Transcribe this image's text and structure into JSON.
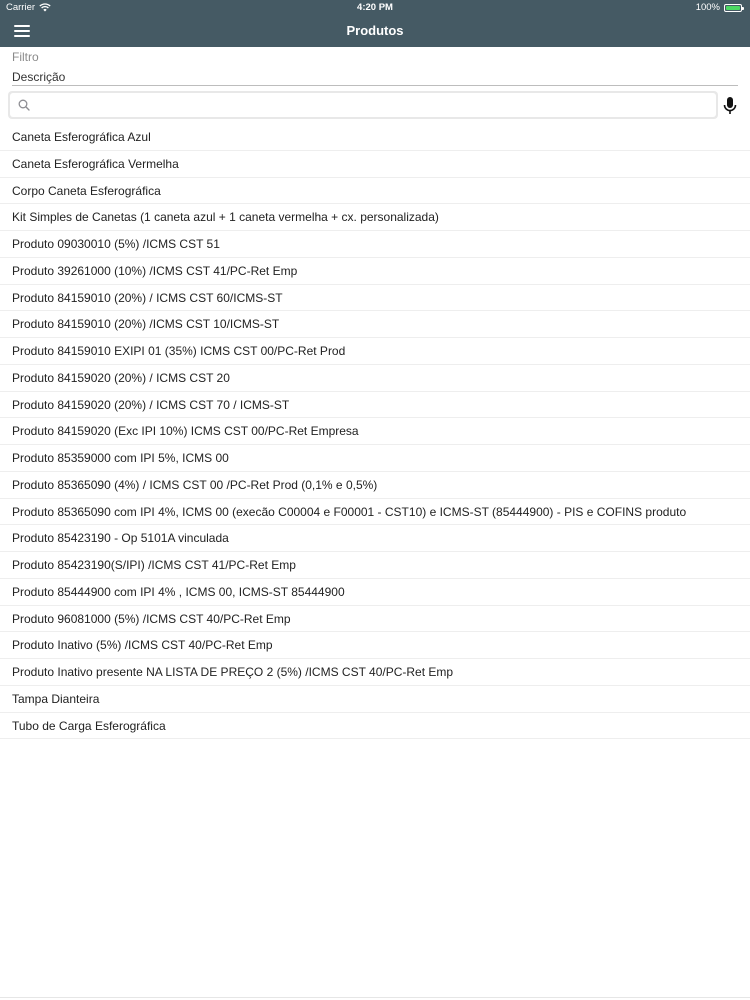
{
  "status_bar": {
    "carrier": "Carrier",
    "time": "4:20 PM",
    "battery": "100%"
  },
  "header": {
    "title": "Produtos",
    "menu_icon": "hamburger-menu-icon",
    "background_color": "#455a64"
  },
  "filter": {
    "label": "Filtro",
    "field_value": "Descrição"
  },
  "search": {
    "placeholder": "",
    "search_icon": "search-icon",
    "mic_icon": "microphone-icon"
  },
  "products": [
    "Caneta Esferográfica Azul",
    "Caneta Esferográfica Vermelha",
    "Corpo Caneta Esferográfica",
    "Kit Simples de Canetas (1 caneta azul + 1 caneta vermelha + cx. personalizada)",
    "Produto 09030010 (5%) /ICMS CST 51",
    "Produto 39261000 (10%) /ICMS CST 41/PC-Ret Emp",
    "Produto 84159010 (20%) / ICMS CST 60/ICMS-ST",
    "Produto 84159010 (20%) /ICMS CST 10/ICMS-ST",
    "Produto 84159010 EXIPI 01 (35%) ICMS CST 00/PC-Ret Prod",
    "Produto 84159020 (20%) / ICMS CST 20",
    "Produto 84159020 (20%) / ICMS CST 70 / ICMS-ST",
    "Produto 84159020 (Exc IPI 10%) ICMS CST 00/PC-Ret Empresa",
    "Produto 85359000 com IPI 5%, ICMS 00",
    "Produto 85365090 (4%) / ICMS CST 00 /PC-Ret Prod (0,1% e 0,5%)",
    "Produto 85365090 com IPI 4%, ICMS 00 (execão C00004 e F00001 - CST10) e  ICMS-ST (85444900) - PIS e COFINS produto",
    "Produto 85423190 - Op 5101A vinculada",
    "Produto 85423190(S/IPI) /ICMS CST 41/PC-Ret Emp",
    "Produto 85444900 com IPI 4% , ICMS 00,  ICMS-ST 85444900",
    "Produto 96081000 (5%) /ICMS CST 40/PC-Ret Emp",
    "Produto Inativo (5%) /ICMS CST 40/PC-Ret Emp",
    "Produto Inativo presente NA LISTA DE PREÇO 2  (5%) /ICMS CST 40/PC-Ret Emp",
    "Tampa Dianteira",
    "Tubo de Carga Esferográfica"
  ]
}
